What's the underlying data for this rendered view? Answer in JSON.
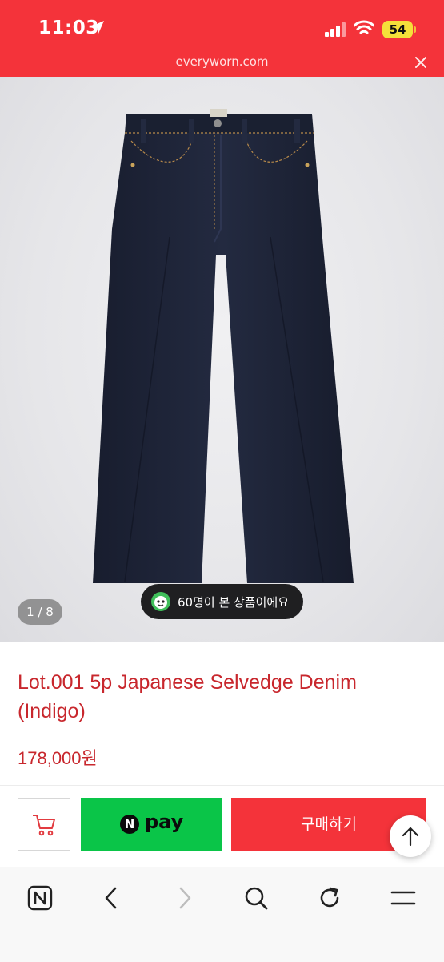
{
  "status_bar": {
    "time": "11:03",
    "battery": "54",
    "url": "everyworn.com"
  },
  "gallery": {
    "counter": "1 / 8",
    "viewers": "60명이 본 상품이에요"
  },
  "product": {
    "title": "Lot.001 5p Japanese Selvedge Denim (Indigo)",
    "price": "178,000원"
  },
  "buy_bar": {
    "npay_badge": "N",
    "npay_label": "pay",
    "buy_label": "구매하기"
  },
  "colors": {
    "brand_red": "#f4333a",
    "text_red": "#c8272d",
    "npay_green": "#0ac548",
    "denim": "#1c2236"
  },
  "icons": [
    "location-arrow-icon",
    "signal-icon",
    "wifi-icon",
    "close-icon",
    "cart-icon",
    "arrow-up-icon",
    "naver-icon",
    "back-icon",
    "forward-icon",
    "search-icon",
    "refresh-icon",
    "menu-icon"
  ]
}
